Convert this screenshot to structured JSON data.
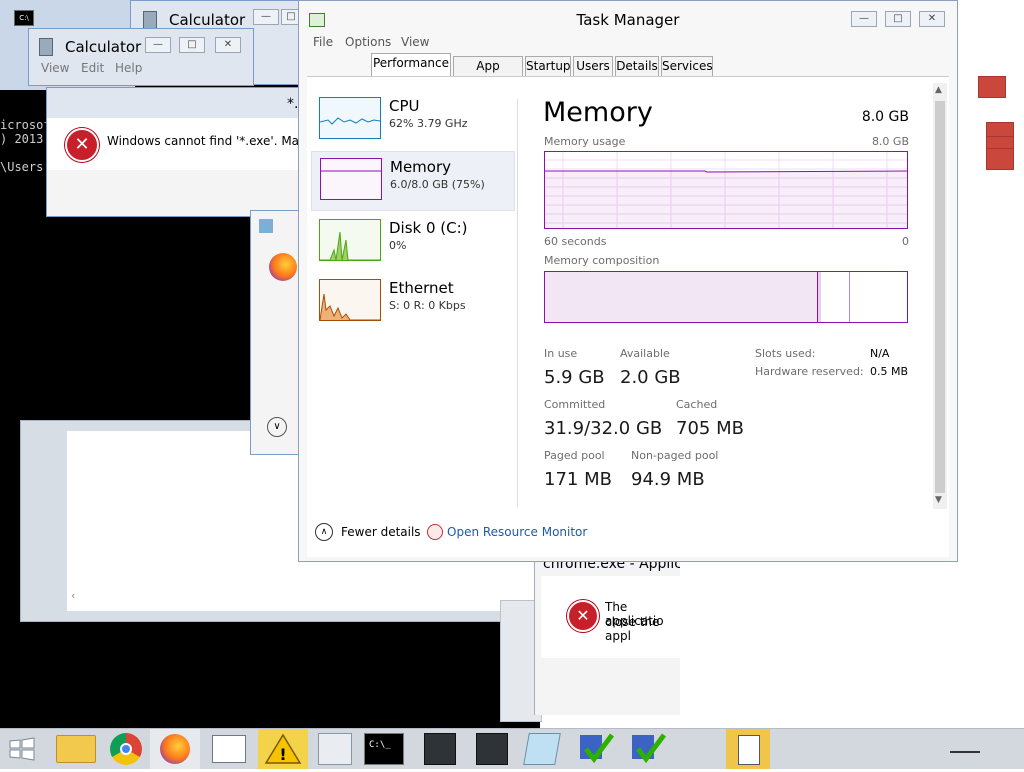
{
  "background_windows": {
    "calc_back": {
      "title": "Calculator"
    },
    "calc_front": {
      "title": "Calculator",
      "menu": [
        "View",
        "Edit",
        "Help"
      ]
    },
    "error_dialog": {
      "title": "*.",
      "message": "Windows cannot find '*.exe'. Make s"
    },
    "console_lines": [
      "icrosof",
      ") 2013",
      "",
      "\\Users"
    ],
    "chrome_error": {
      "title": "chrome.exe - Applic",
      "message_line1": "The applicatio",
      "message_line2": "close the appl"
    }
  },
  "task_manager": {
    "title": "Task Manager",
    "menu": [
      "File",
      "Options",
      "View"
    ],
    "tabs": [
      "Performance",
      "App history",
      "Startup",
      "Users",
      "Details",
      "Services"
    ],
    "active_tab": "Performance",
    "sidebar": [
      {
        "name": "CPU",
        "detail": "62%  3.79 GHz",
        "color": "#117dbb"
      },
      {
        "name": "Memory",
        "detail": "6.0/8.0 GB (75%)",
        "color": "#8b12ae"
      },
      {
        "name": "Disk 0 (C:)",
        "detail": "0%",
        "color": "#4da60c"
      },
      {
        "name": "Ethernet",
        "detail": "S: 0  R: 0 Kbps",
        "color": "#a74f01"
      }
    ],
    "memory": {
      "heading": "Memory",
      "total": "8.0 GB",
      "usage_label": "Memory usage",
      "usage_max": "8.0 GB",
      "time_left": "60 seconds",
      "time_right": "0",
      "composition_label": "Memory composition",
      "in_use_label": "In use",
      "in_use": "5.9 GB",
      "available_label": "Available",
      "available": "2.0 GB",
      "committed_label": "Committed",
      "committed": "31.9/32.0 GB",
      "cached_label": "Cached",
      "cached": "705 MB",
      "paged_label": "Paged pool",
      "paged": "171 MB",
      "nonpaged_label": "Non-paged pool",
      "nonpaged": "94.9 MB",
      "slots_label": "Slots used:",
      "slots": "N/A",
      "hw_label": "Hardware reserved:",
      "hw": "0.5 MB"
    },
    "footer": {
      "fewer_details": "Fewer details",
      "open_resmon": "Open Resource Monitor"
    }
  },
  "colors": {
    "memory": "#8b12ae",
    "cpu": "#117dbb",
    "disk": "#4da60c",
    "ethernet": "#a74f01",
    "link": "#1e5aa8"
  }
}
